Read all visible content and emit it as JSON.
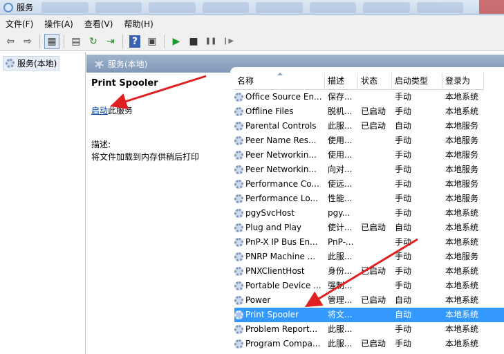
{
  "window": {
    "title": "服务"
  },
  "menu": [
    "文件(F)",
    "操作(A)",
    "查看(V)",
    "帮助(H)"
  ],
  "toolbar": {
    "buttons": [
      {
        "icon": "back-arrow-icon",
        "glyph": "⇦"
      },
      {
        "icon": "forward-arrow-icon",
        "glyph": "⇨"
      },
      {
        "icon": "show-tree-icon",
        "glyph": "▦"
      },
      {
        "icon": "properties-icon",
        "glyph": "▤"
      },
      {
        "icon": "refresh-icon",
        "glyph": "↻"
      },
      {
        "icon": "export-icon",
        "glyph": "⇥"
      },
      {
        "icon": "help-icon",
        "glyph": "?"
      },
      {
        "icon": "console-icon",
        "glyph": "▣"
      },
      {
        "icon": "start-icon",
        "glyph": "▶"
      },
      {
        "icon": "stop-icon",
        "glyph": "■"
      },
      {
        "icon": "pause-icon",
        "glyph": "❚❚"
      },
      {
        "icon": "resume-icon",
        "glyph": "❙▶"
      }
    ]
  },
  "tree": {
    "item": "服务(本地)"
  },
  "panel": {
    "header": "服务(本地)"
  },
  "description": {
    "service_name": "Print Spooler",
    "start_link": "启动",
    "start_suffix": "此服务",
    "desc_label": "描述:",
    "desc_text": "将文件加载到内存供稍后打印"
  },
  "table": {
    "columns": [
      "名称",
      "描述",
      "状态",
      "启动类型",
      "登录为"
    ],
    "rows": [
      {
        "name": "Office Source En...",
        "desc": "保存...",
        "status": "",
        "startup": "手动",
        "logon": "本地系统"
      },
      {
        "name": "Offline Files",
        "desc": "脱机...",
        "status": "已启动",
        "startup": "手动",
        "logon": "本地系统"
      },
      {
        "name": "Parental Controls",
        "desc": "此服...",
        "status": "已启动",
        "startup": "自动",
        "logon": "本地服务"
      },
      {
        "name": "Peer Name Res...",
        "desc": "使用...",
        "status": "",
        "startup": "手动",
        "logon": "本地服务"
      },
      {
        "name": "Peer Networkin...",
        "desc": "使用...",
        "status": "",
        "startup": "手动",
        "logon": "本地服务"
      },
      {
        "name": "Peer Networkin...",
        "desc": "向对...",
        "status": "",
        "startup": "手动",
        "logon": "本地服务"
      },
      {
        "name": "Performance Co...",
        "desc": "使远...",
        "status": "",
        "startup": "手动",
        "logon": "本地服务"
      },
      {
        "name": "Performance Lo...",
        "desc": "性能...",
        "status": "",
        "startup": "手动",
        "logon": "本地服务"
      },
      {
        "name": "pgySvcHost",
        "desc": "pgy...",
        "status": "",
        "startup": "手动",
        "logon": "本地系统"
      },
      {
        "name": "Plug and Play",
        "desc": "使计...",
        "status": "已启动",
        "startup": "自动",
        "logon": "本地系统"
      },
      {
        "name": "PnP-X IP Bus En...",
        "desc": "PnP-...",
        "status": "",
        "startup": "手动",
        "logon": "本地系统"
      },
      {
        "name": "PNRP Machine ...",
        "desc": "此服...",
        "status": "",
        "startup": "手动",
        "logon": "本地服务"
      },
      {
        "name": "PNXClientHost",
        "desc": "身份...",
        "status": "已启动",
        "startup": "手动",
        "logon": "本地系统"
      },
      {
        "name": "Portable Device ...",
        "desc": "强制...",
        "status": "",
        "startup": "手动",
        "logon": "本地系统"
      },
      {
        "name": "Power",
        "desc": "管理...",
        "status": "已启动",
        "startup": "自动",
        "logon": "本地系统"
      },
      {
        "name": "Print Spooler",
        "desc": "将文...",
        "status": "",
        "startup": "自动",
        "logon": "本地系统",
        "selected": true
      },
      {
        "name": "Problem Report...",
        "desc": "此服...",
        "status": "",
        "startup": "手动",
        "logon": "本地系统"
      },
      {
        "name": "Program Compa...",
        "desc": "此服...",
        "status": "已启动",
        "startup": "手动",
        "logon": "本地系统"
      }
    ]
  },
  "colors": {
    "selection": "#3399ff",
    "header_band": "#8ea7c2",
    "annotation_arrow": "#e02020"
  }
}
